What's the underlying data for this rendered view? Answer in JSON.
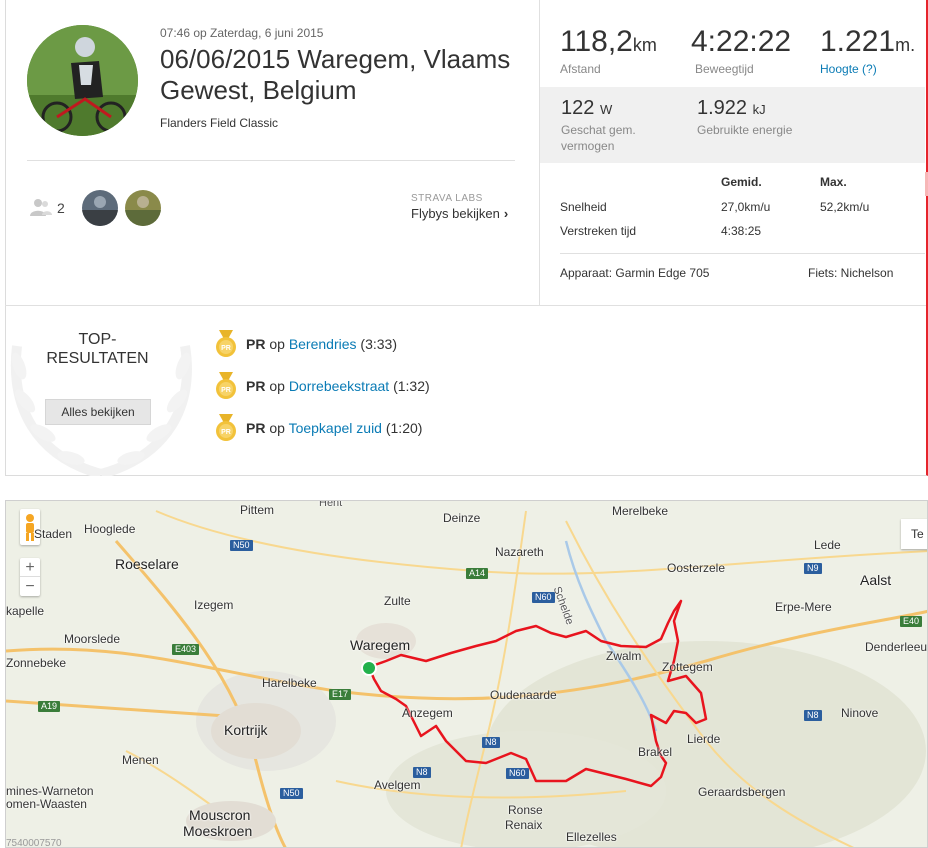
{
  "activity": {
    "datetime": "07:46 op Zaterdag, 6 juni 2015",
    "title": "06/06/2015 Waregem, Vlaams Gewest, Belgium",
    "description": "Flanders Field Classic",
    "athlete_count": "2",
    "labs_label": "STRAVA LABS",
    "flyby_label": "Flybys bekijken"
  },
  "stats": {
    "distance_value": "118,2",
    "distance_unit": "km",
    "distance_label": "Afstand",
    "moving_time_value": "4:22:22",
    "moving_time_label": "Beweegtijd",
    "elevation_value": "1.221",
    "elevation_unit": "m.",
    "elevation_label": "Hoogte (?)",
    "power_value": "122",
    "power_unit": "W",
    "power_label_1": "Geschat gem.",
    "power_label_2": "vermogen",
    "energy_value": "1.922",
    "energy_unit": "kJ",
    "energy_label": "Gebruikte energie",
    "table": {
      "col_avg": "Gemid.",
      "col_max": "Max.",
      "rows": [
        {
          "label": "Snelheid",
          "avg": "27,0km/u",
          "max": "52,2km/u"
        },
        {
          "label": "Verstreken tijd",
          "avg": "4:38:25",
          "max": ""
        }
      ]
    },
    "device": "Apparaat: Garmin Edge 705",
    "bike": "Fiets: Nichelson"
  },
  "results": {
    "title": "TOP-RESULTATEN",
    "see_all": "Alles bekijken",
    "items": [
      {
        "badge": "PR",
        "on": "op",
        "segment": "Berendries",
        "time": "(3:33)"
      },
      {
        "badge": "PR",
        "on": "op",
        "segment": "Dorrebeekstraat",
        "time": "(1:32)"
      },
      {
        "badge": "PR",
        "on": "op",
        "segment": "Toepkapel zuid",
        "time": "(1:20)"
      }
    ]
  },
  "map": {
    "zoom_in": "+",
    "zoom_out": "−",
    "maptype": "Te",
    "coords": "7540007570",
    "places": [
      "Pittem",
      "Deinze",
      "Merelbeke",
      "Staden",
      "Hooglede",
      "Nazareth",
      "Lede",
      "Roeselare",
      "Oosterzele",
      "Aalst",
      "Izegem",
      "Zulte",
      "Erpe-Mere",
      "kapelle",
      "Moorslede",
      "Waregem",
      "Denderleeu",
      "Zonnebeke",
      "Zwalm",
      "Zottegem",
      "Harelbeke",
      "Oudenaarde",
      "Anzegem",
      "Ninove",
      "Kortrijk",
      "Lierde",
      "Brakel",
      "Menen",
      "Avelgem",
      "Geraardsbergen",
      "mines-Warneton",
      "omen-Waasten",
      "Mouscron",
      "Moeskroen",
      "Ronse",
      "Renaix",
      "Ellezelles",
      "Schelde",
      "Hent"
    ],
    "roads": [
      "N50",
      "A14",
      "N60",
      "N9",
      "E403",
      "E40",
      "E17",
      "A19",
      "N8",
      "N8",
      "N8",
      "N60",
      "N50"
    ],
    "colors": {
      "route": "#e8141e",
      "start": "#22b14c"
    }
  },
  "colors": {
    "link": "#0a7bb5",
    "accent_border": "#e6242b"
  }
}
